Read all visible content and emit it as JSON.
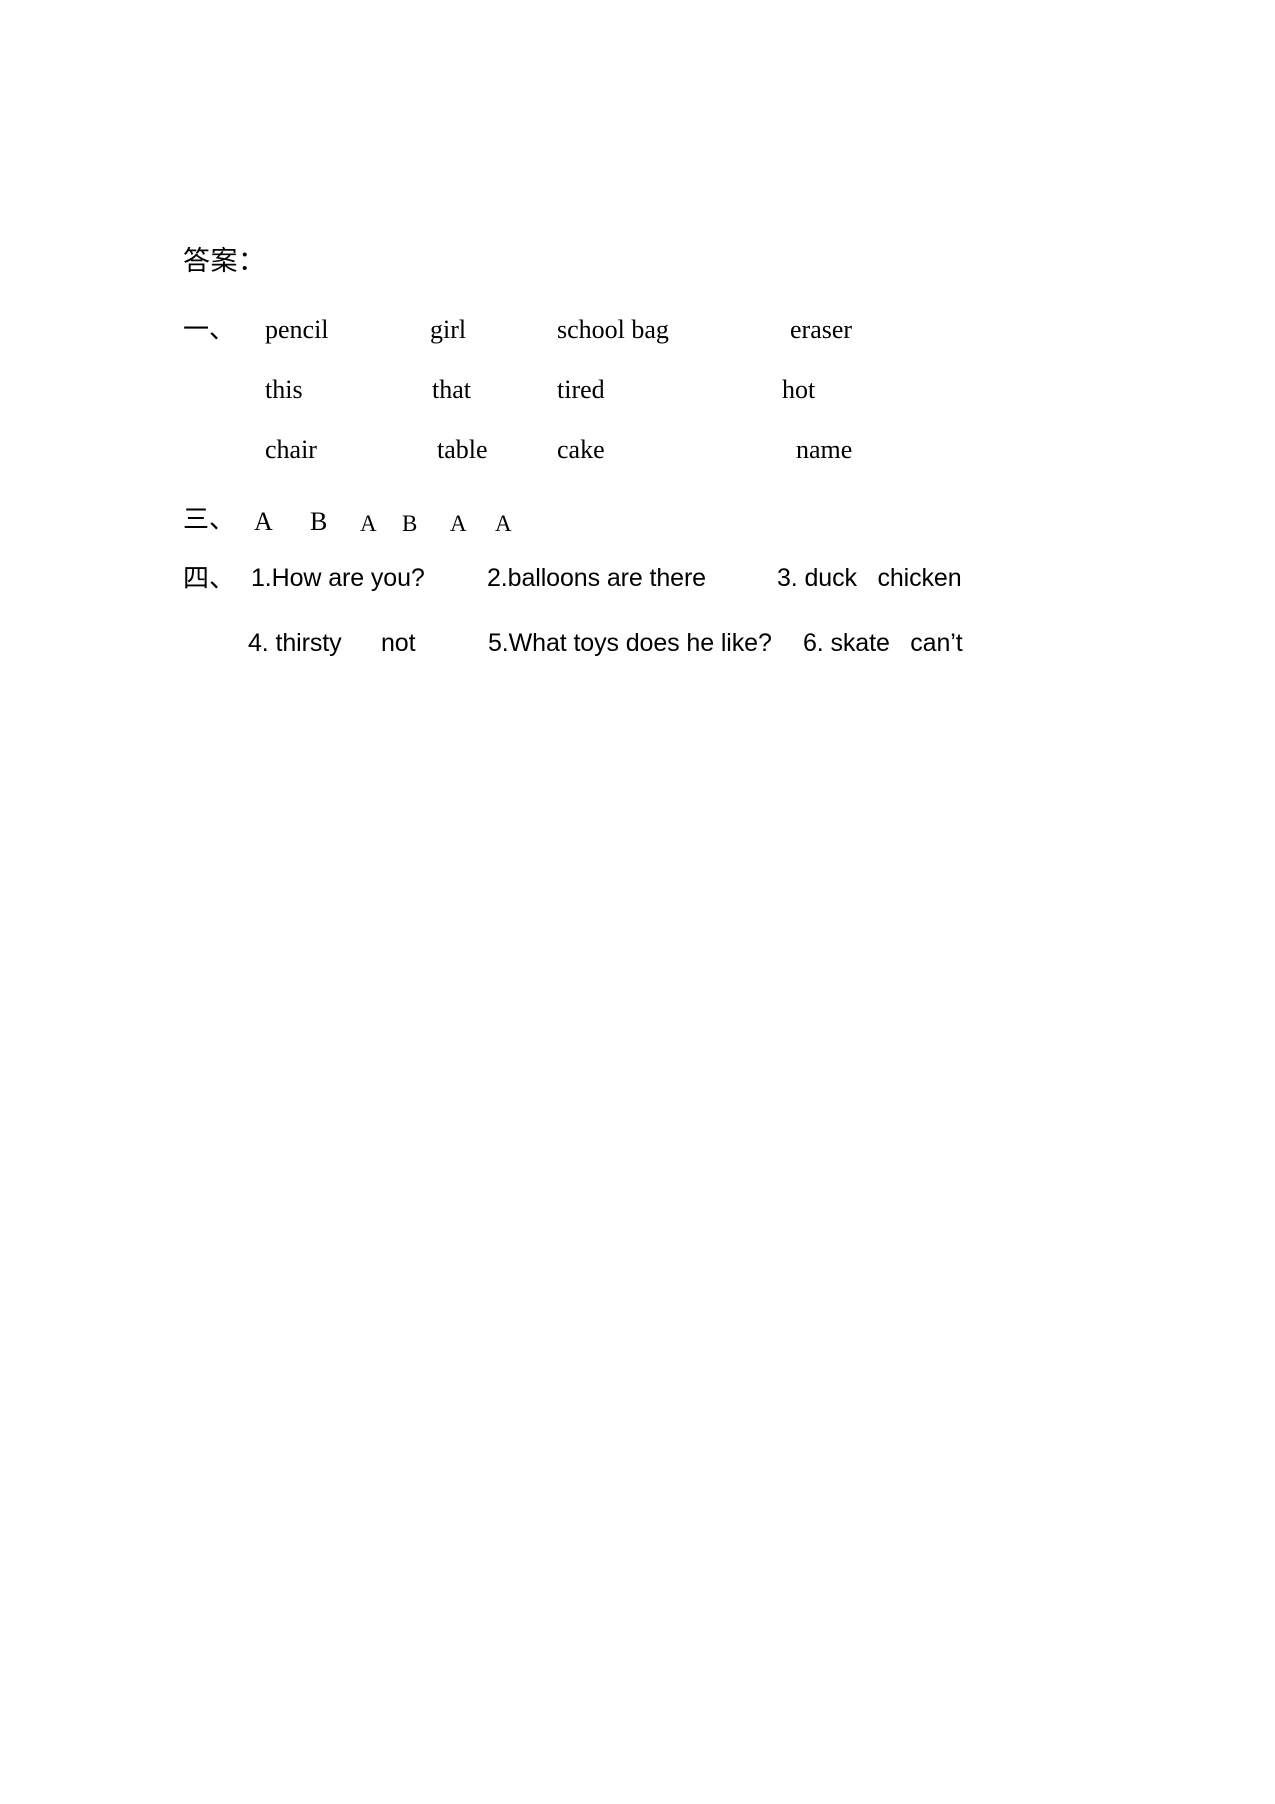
{
  "document": {
    "heading": "答案：",
    "background_color": "#ffffff",
    "text_color": "#000000"
  },
  "sections": [
    {
      "marker": "一、",
      "type": "word-list",
      "rows": [
        {
          "cells": [
            "pencil",
            "girl",
            "school bag",
            "eraser"
          ]
        },
        {
          "cells": [
            "this",
            "that",
            "tired",
            "hot"
          ]
        },
        {
          "cells": [
            "chair",
            "table",
            "cake",
            "name"
          ]
        }
      ]
    },
    {
      "marker": "三、",
      "type": "letter-answers",
      "letters": [
        "A",
        "B",
        "A",
        "B",
        "A",
        "A"
      ]
    },
    {
      "marker": "四、",
      "type": "sentence-answers",
      "lines": [
        {
          "items": [
            "1.How are you?",
            "2.balloons are there",
            "3. duck   chicken"
          ]
        },
        {
          "items": [
            "4. thirsty",
            "not",
            "5.What toys does he like?",
            "6. skate   can’t"
          ]
        }
      ]
    }
  ]
}
